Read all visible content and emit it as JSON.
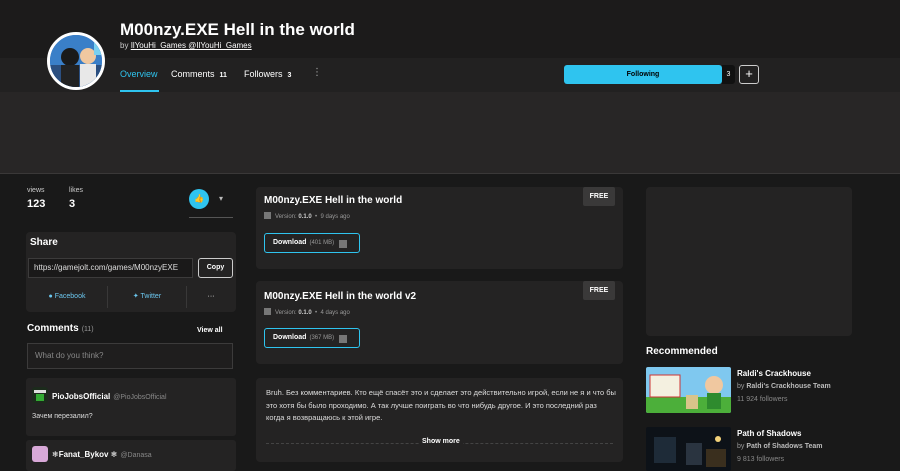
{
  "game": {
    "title": "M00nzy.EXE Hell in the world",
    "by_prefix": "by",
    "author_name": "IlYouHi_Games",
    "author_handle": "@IlYouHi_Games"
  },
  "tabs": [
    {
      "label": "Overview",
      "count": ""
    },
    {
      "label": "Comments",
      "count": "11"
    },
    {
      "label": "Followers",
      "count": "3"
    }
  ],
  "follow": {
    "label": "Following",
    "count": "3",
    "plus": "+"
  },
  "stats": {
    "views_label": "views",
    "views": "123",
    "likes_label": "likes",
    "likes": "3"
  },
  "share": {
    "title": "Share",
    "url": "https://gamejolt.com/games/M00nzyEXE",
    "copy_label": "Copy",
    "facebook": "Facebook",
    "twitter": "Twitter",
    "more": "···"
  },
  "comments": {
    "title": "Comments",
    "count": "(11)",
    "view_all": "View all",
    "placeholder": "What do you think?",
    "items": [
      {
        "name": "PioJobsOfficial",
        "handle": "@PioJobsOfficial",
        "text": "Зачем перезалил?"
      },
      {
        "name": "❄Fanat_Bykov ❄",
        "handle": "@Danasa",
        "text": ""
      }
    ]
  },
  "packages": [
    {
      "title": "M00nzy.EXE Hell in the world",
      "version_label": "Version:",
      "version": "0.1.0",
      "age": "9 days ago",
      "badge": "FREE",
      "download_label": "Download",
      "size": "(401 MB)"
    },
    {
      "title": "M00nzy.EXE Hell in the world v2",
      "version_label": "Version:",
      "version": "0.1.0",
      "age": "4 days ago",
      "badge": "FREE",
      "download_label": "Download",
      "size": "(367 MB)"
    }
  ],
  "description": {
    "text": "Bruh. Без комментариев. Кто ещё спасёт это и сделает это действительно игрой, если не я и что бы это хотя бы было проходимо. А так лучше поиграть во что нибудь другое. И это последний раз когда я возвращаюсь к этой игре.",
    "show_more": "Show more"
  },
  "recommended": {
    "title": "Recommended",
    "items": [
      {
        "name": "Raldi's Crackhouse",
        "by_prefix": "by",
        "by": "Raldi's Crackhouse Team",
        "followers": "11 924 followers"
      },
      {
        "name": "Path of Shadows",
        "by_prefix": "by",
        "by": "Path of Shadows Team",
        "followers": "9 813 followers"
      }
    ]
  },
  "colors": {
    "accent": "#2fc4ef",
    "background": "#191919",
    "panel": "#242323"
  }
}
